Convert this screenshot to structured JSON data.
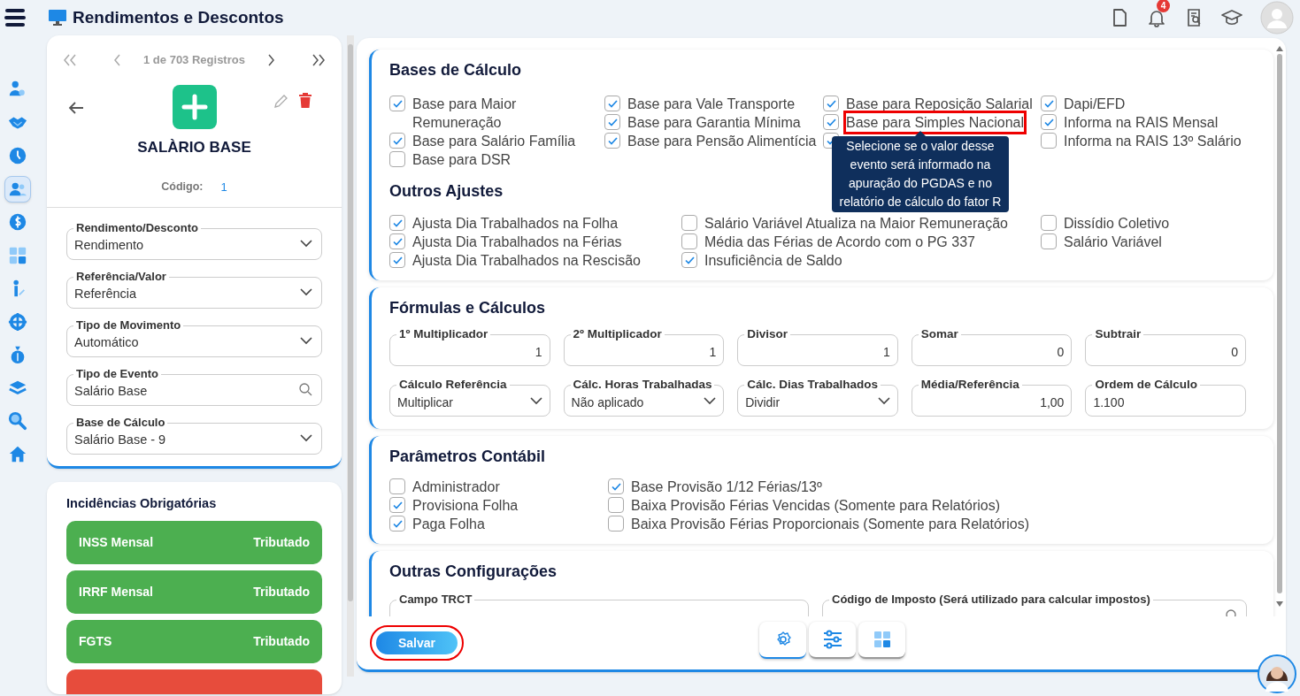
{
  "header": {
    "title": "Rendimentos e Descontos",
    "notification_count": "4"
  },
  "nav_rail": [
    {
      "selected": false
    },
    {
      "selected": false
    },
    {
      "selected": false
    },
    {
      "selected": true
    },
    {
      "selected": false
    },
    {
      "selected": false
    },
    {
      "selected": false
    },
    {
      "selected": false
    },
    {
      "selected": false
    },
    {
      "selected": false
    },
    {
      "selected": false
    },
    {
      "selected": false
    }
  ],
  "record": {
    "pager": "1 de 703 Registros",
    "title": "SALÀRIO BASE",
    "code_label": "Código:",
    "code": "1"
  },
  "record_fields": [
    {
      "label": "Rendimento/Desconto",
      "value": "Rendimento",
      "kind": "select"
    },
    {
      "label": "Referência/Valor",
      "value": "Referência",
      "kind": "select"
    },
    {
      "label": "Tipo de Movimento",
      "value": "Automático",
      "kind": "select"
    },
    {
      "label": "Tipo de Evento",
      "value": "Salário Base",
      "kind": "search"
    },
    {
      "label": "Base de Cálculo",
      "value": "Salário Base - 9",
      "kind": "select"
    }
  ],
  "incidences": {
    "title": "Incidências Obrigatórias",
    "items": [
      {
        "name": "INSS Mensal",
        "status": "Tributado",
        "color": "#4caf50"
      },
      {
        "name": "IRRF Mensal",
        "status": "Tributado",
        "color": "#4caf50"
      },
      {
        "name": "FGTS",
        "status": "Tributado",
        "color": "#4caf50"
      },
      {
        "color": "#e74c3c"
      }
    ]
  },
  "bases": {
    "title": "Bases de Cálculo",
    "columns": [
      [
        {
          "label": "Base para Maior Remuneração",
          "checked": true
        },
        {
          "label": "Base para Salário Família",
          "checked": true
        },
        {
          "label": "Base para DSR",
          "checked": false
        }
      ],
      [
        {
          "label": "Base para Vale Transporte",
          "checked": true
        },
        {
          "label": "Base para Garantia Mínima",
          "checked": true
        },
        {
          "label": "Base para Pensão Alimentícia",
          "checked": true
        }
      ],
      [
        {
          "label": "Base para Reposição Salarial",
          "checked": true
        },
        {
          "label": "Base para Simples Nacional",
          "checked": true,
          "highlighted": true
        },
        {
          "checked": true
        }
      ],
      [
        {
          "label": "Dapi/EFD",
          "checked": true
        },
        {
          "label": "Informa na RAIS Mensal",
          "checked": true
        },
        {
          "label": "Informa na RAIS 13º Salário",
          "checked": false
        }
      ]
    ],
    "tooltip": "Selecione se o valor desse evento será informado na apuração do PGDAS e no relatório de cálculo do fator R"
  },
  "adjustments": {
    "title": "Outros Ajustes",
    "columns": [
      [
        {
          "label": "Ajusta Dia Trabalhados na Folha",
          "checked": true
        },
        {
          "label": "Ajusta Dia Trabalhados na Férias",
          "checked": true
        },
        {
          "label": "Ajusta Dia Trabalhados na Rescisão",
          "checked": true
        }
      ],
      [
        {
          "label": "Salário Variável Atualiza na Maior Remuneração",
          "checked": false
        },
        {
          "label": "Média das Férias de Acordo com o PG 337",
          "checked": false
        },
        {
          "label": "Insuficiência de Saldo",
          "checked": true
        }
      ],
      [
        {
          "label": "Dissídio Coletivo",
          "checked": false
        },
        {
          "label": "Salário Variável",
          "checked": false
        }
      ]
    ]
  },
  "formulas": {
    "title": "Fórmulas e Cálculos",
    "fields": [
      {
        "label": "1º Multiplicador",
        "value": "1",
        "kind": "number"
      },
      {
        "label": "2º Multiplicador",
        "value": "1",
        "kind": "number"
      },
      {
        "label": "Divisor",
        "value": "1",
        "kind": "number"
      },
      {
        "label": "Somar",
        "value": "0",
        "kind": "number"
      },
      {
        "label": "Subtrair",
        "value": "0",
        "kind": "number"
      },
      {
        "label": "Cálculo Referência",
        "value": "Multiplicar",
        "kind": "select"
      },
      {
        "label": "Cálc. Horas Trabalhadas",
        "value": "Não aplicado",
        "kind": "select"
      },
      {
        "label": "Cálc. Dias Trabalhados",
        "value": "Dividir",
        "kind": "select"
      },
      {
        "label": "Média/Referência",
        "value": "1,00",
        "kind": "number"
      },
      {
        "label": "Ordem de Cálculo",
        "value": "1.100",
        "kind": "text"
      }
    ]
  },
  "accounting": {
    "title": "Parâmetros Contábil",
    "columns": [
      [
        {
          "label": "Administrador",
          "checked": false
        },
        {
          "label": "Provisiona Folha",
          "checked": true
        },
        {
          "label": "Paga Folha",
          "checked": true
        }
      ],
      [
        {
          "label": "Base Provisão 1/12 Férias/13º",
          "checked": true
        },
        {
          "label": "Baixa Provisão Férias Vencidas (Somente para Relatórios)",
          "checked": false
        },
        {
          "label": "Baixa Provisão Férias Proporcionais (Somente para Relatórios)",
          "checked": false
        }
      ]
    ]
  },
  "other": {
    "title": "Outras Configurações",
    "fields": [
      {
        "label": "Campo TRCT"
      },
      {
        "label": "Código de Imposto (Será utilizado para calcular impostos)"
      }
    ]
  },
  "footer": {
    "save_button": {
      "label": "Salvar",
      "highlighted": true
    },
    "tabs": [
      {
        "selected": true
      },
      {
        "selected": false
      },
      {
        "selected": false
      }
    ]
  }
}
